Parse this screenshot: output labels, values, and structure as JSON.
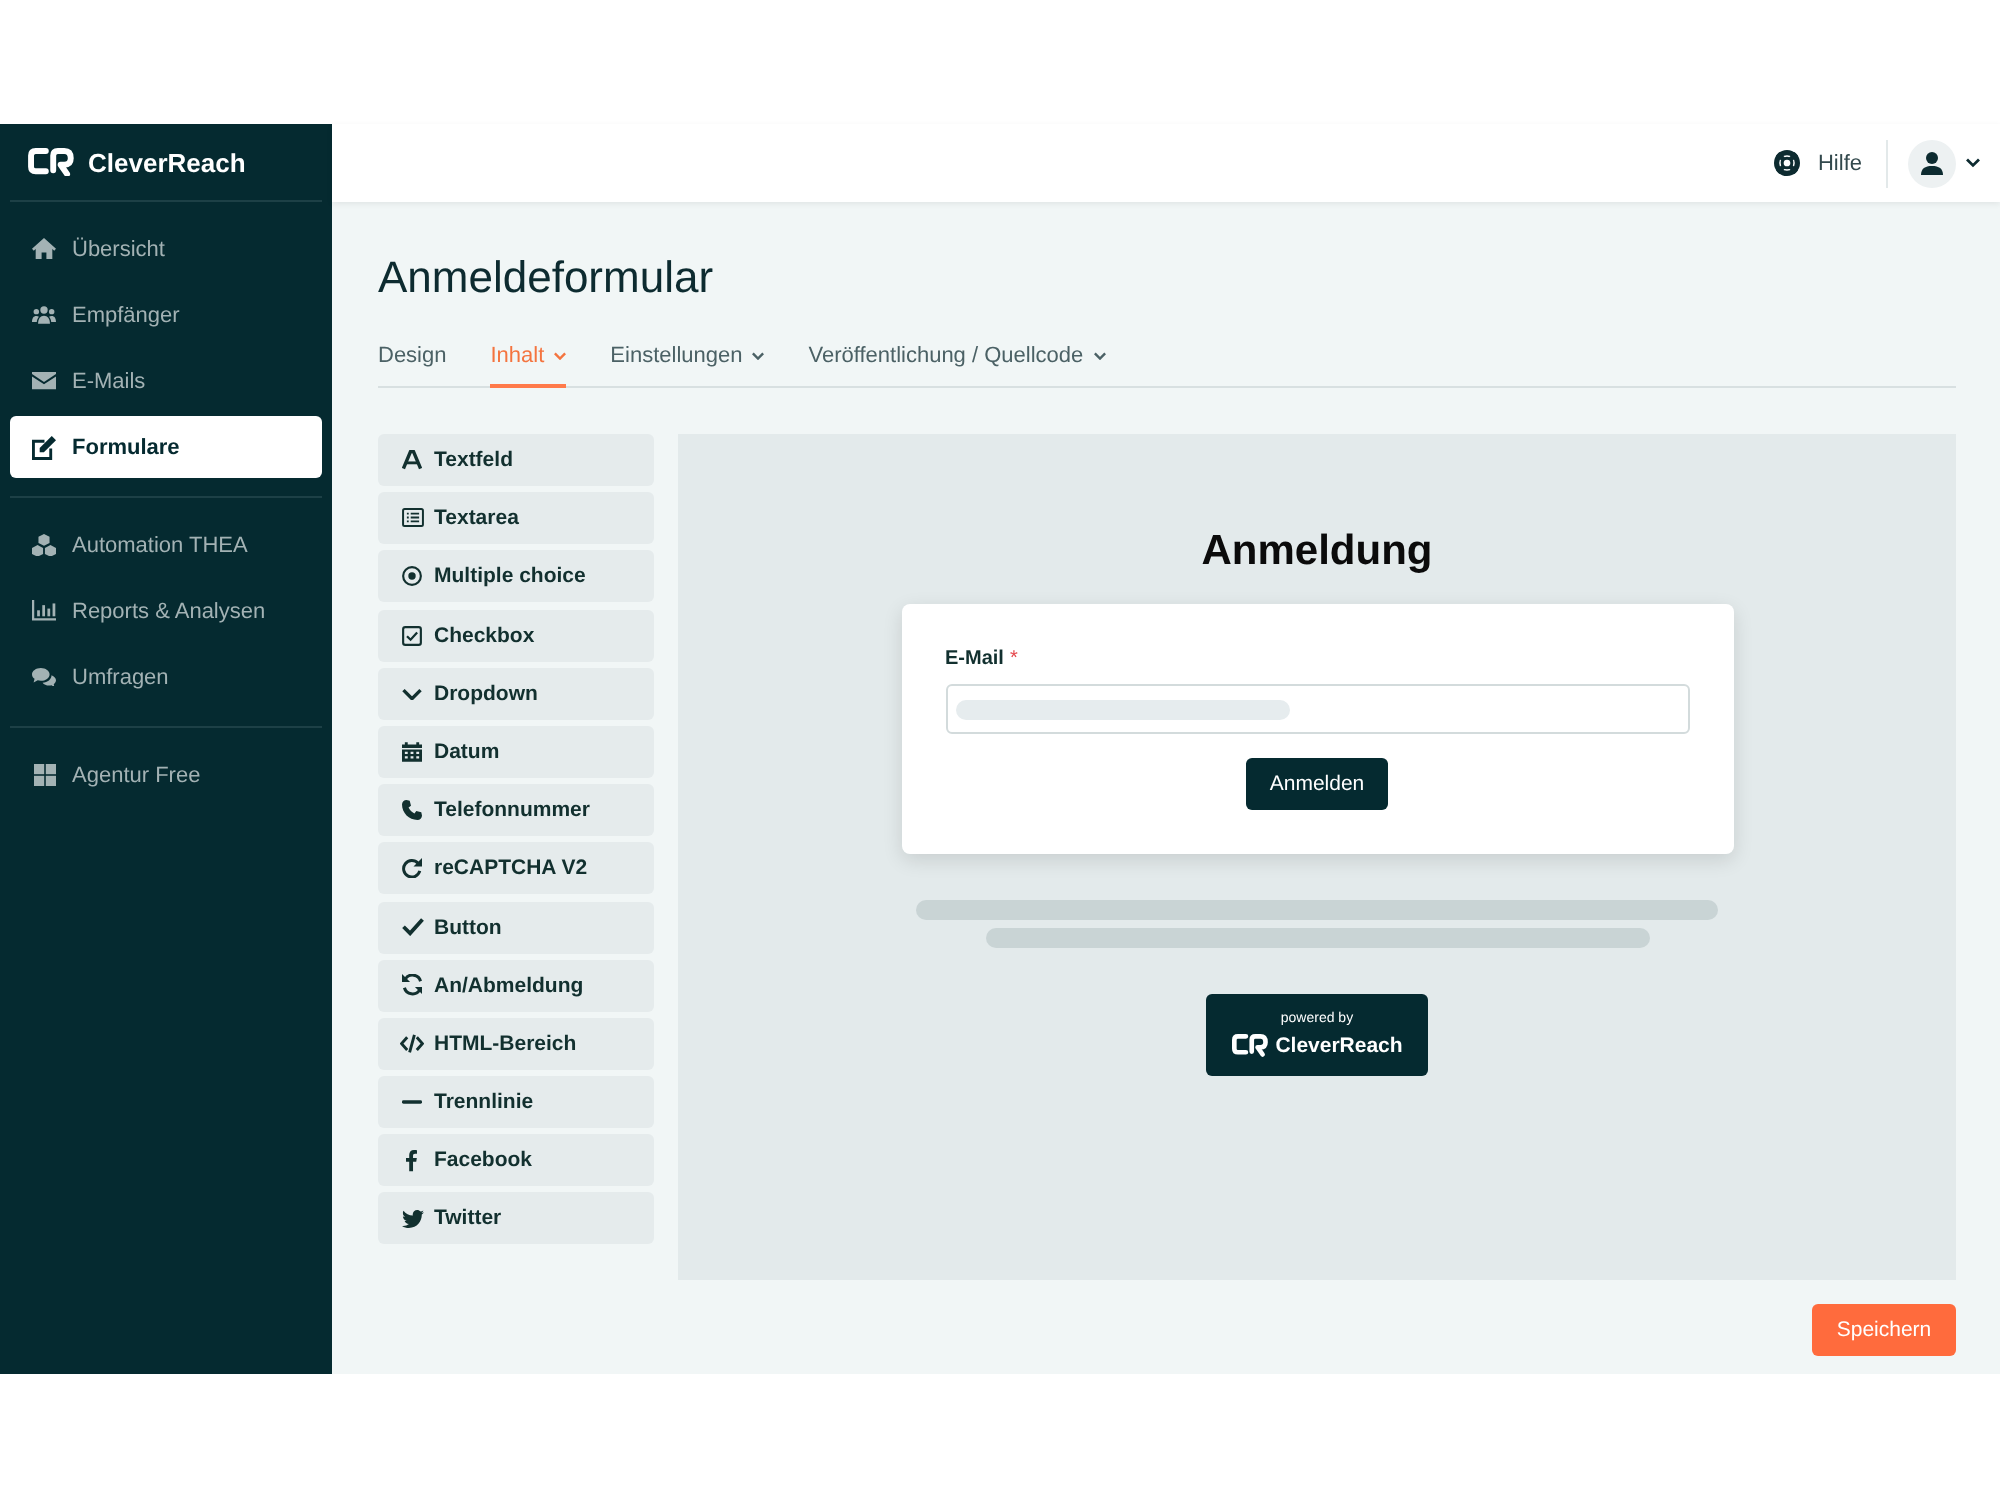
{
  "sidebar": {
    "brand": "CleverReach",
    "sections": [
      {
        "items": [
          {
            "label": "Übersicht",
            "selected": false
          },
          {
            "label": "Empfänger",
            "selected": false
          },
          {
            "label": "E-Mails",
            "selected": false
          },
          {
            "label": "Formulare",
            "selected": true
          }
        ]
      },
      {
        "items": [
          {
            "label": "Automation THEA",
            "selected": false
          },
          {
            "label": "Reports & Analysen",
            "selected": false
          },
          {
            "label": "Umfragen",
            "selected": false
          }
        ]
      },
      {
        "items": [
          {
            "label": "Agentur Free",
            "selected": false
          }
        ]
      }
    ]
  },
  "topbar": {
    "help": "Hilfe"
  },
  "page": {
    "title": "Anmeldeformular",
    "tabs": [
      {
        "label": "Design",
        "selected": false,
        "dropdown": false
      },
      {
        "label": "Inhalt",
        "selected": true,
        "dropdown": true
      },
      {
        "label": "Einstellungen",
        "selected": false,
        "dropdown": true
      },
      {
        "label": "Veröffentlichung / Quellcode",
        "selected": false,
        "dropdown": true
      }
    ]
  },
  "elements": [
    {
      "label": "Textfeld"
    },
    {
      "label": "Textarea"
    },
    {
      "label": "Multiple choice"
    },
    {
      "label": "Checkbox"
    },
    {
      "label": "Dropdown"
    },
    {
      "label": "Datum"
    },
    {
      "label": "Telefonnummer"
    },
    {
      "label": "reCAPTCHA V2"
    },
    {
      "label": "Button"
    },
    {
      "label": "An/Abmeldung"
    },
    {
      "label": "HTML-Bereich"
    },
    {
      "label": "Trennlinie"
    },
    {
      "label": "Facebook"
    },
    {
      "label": "Twitter"
    }
  ],
  "preview": {
    "title": "Anmeldung",
    "field": {
      "label": "E-Mail",
      "required_mark": "*"
    },
    "submit": "Anmelden",
    "badge": {
      "caption": "powered by",
      "brand": "CleverReach"
    }
  },
  "save": "Speichern"
}
